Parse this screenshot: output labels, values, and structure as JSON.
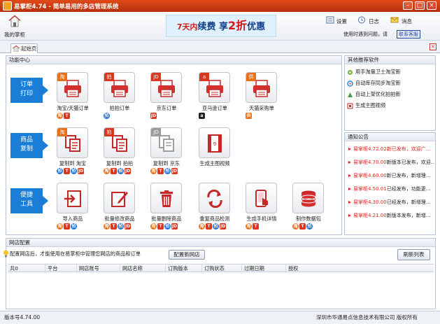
{
  "window": {
    "title": "易掌柜4.74 - 简单易用的多店管理系统"
  },
  "header": {
    "home_label": "我的掌柜",
    "banner": {
      "part1": "7天内",
      "part2": "续费 享",
      "part3": "2折",
      "part4": "优惠"
    },
    "settings_label": "设置",
    "log_label": "日志",
    "messages_label": "消息",
    "help_text": "使用时遇到问题，请",
    "help_link": "联系客服"
  },
  "tabs": [
    {
      "label": "起始页"
    }
  ],
  "function_center": {
    "title": "功能中心",
    "rows": [
      {
        "label_line1": "订单",
        "label_line2": "打印",
        "items": [
          {
            "label": "淘宝/天猫订单",
            "tag": "淘",
            "tag_color": "#e8711a",
            "badges": [
              "淘",
              "T"
            ]
          },
          {
            "label": "拍拍订单",
            "tag": "拍",
            "tag_color": "#d8361e",
            "badges": [
              "拍"
            ]
          },
          {
            "label": "京东订单",
            "tag": "JD",
            "tag_color": "#d8361e",
            "badges": [
              "JD"
            ]
          },
          {
            "label": "亚马逊订单",
            "tag": "a",
            "tag_color": "#d8361e",
            "badges": [
              "a"
            ]
          },
          {
            "label": "天猫采购单",
            "tag": "供",
            "tag_color": "#e8711a",
            "badges": [
              "供"
            ]
          }
        ]
      },
      {
        "label_line1": "商品",
        "label_line2": "复制",
        "items": [
          {
            "label": "复制到 淘宝",
            "tag": "淘",
            "tag_color": "#e8711a",
            "badges": [
              "拍",
              "T",
              "拍",
              "JD"
            ]
          },
          {
            "label": "复制到 拍拍",
            "tag": "拍",
            "tag_color": "#d8361e",
            "badges": [
              "淘",
              "T",
              "拍",
              "JD"
            ]
          },
          {
            "label": "复制到 京东",
            "tag": "JD",
            "tag_color": "#9c9c9c",
            "badges": [
              "淘",
              "T",
              "拍",
              "JD"
            ]
          },
          {
            "label": "生成主图视频",
            "tag": "",
            "tag_color": "",
            "badges": []
          }
        ]
      },
      {
        "label_line1": "便捷",
        "label_line2": "工具",
        "items": [
          {
            "label": "导入商品",
            "tag": "",
            "tag_color": "",
            "badges": [
              "淘",
              "T",
              "拍"
            ]
          },
          {
            "label": "批量修改商品",
            "tag": "",
            "tag_color": "",
            "badges": [
              "淘",
              "T",
              "拍",
              "JD"
            ]
          },
          {
            "label": "批量删除商品",
            "tag": "",
            "tag_color": "",
            "badges": [
              "淘",
              "T",
              "拍",
              "JD"
            ]
          },
          {
            "label": "重复商品检测",
            "tag": "",
            "tag_color": "",
            "badges": [
              "淘",
              "T",
              "拍",
              "JD"
            ]
          },
          {
            "label": "生成手机详情",
            "tag": "",
            "tag_color": "",
            "badges": [
              "淘",
              "T"
            ]
          },
          {
            "label": "制作数据包",
            "tag": "",
            "tag_color": "",
            "badges": [
              "淘",
              "T",
              "拍"
            ]
          }
        ]
      }
    ]
  },
  "recommend": {
    "title": "其他推荐软件",
    "items": [
      {
        "label": "用手淘量卫士淘宝新"
      },
      {
        "label": "自动库存同步淘宝新"
      },
      {
        "label": "自动上架优化拍拍新"
      },
      {
        "label": "生成主图视频"
      }
    ]
  },
  "notice": {
    "title": "通知公告",
    "items": [
      {
        "version": "易掌柜4.72.02",
        "text": "新已发布，欢迎广..."
      },
      {
        "version": "易掌柜4.70.00",
        "text": "新版本已发布，欢迎..."
      },
      {
        "version": "易掌柜4.60.00",
        "text": "新已发布，新增理..."
      },
      {
        "version": "易掌柜4.50.01",
        "text": "已经发布，功能更..."
      },
      {
        "version": "易掌柜4.30.00",
        "text": "已经发布，新增理..."
      },
      {
        "version": "易掌柜4.21.00",
        "text": "新版本发布，新增..."
      }
    ]
  },
  "store_config": {
    "title": "网店配置",
    "tip": "配置网店后，才能使用在易掌柜中管理您网店的商品和订单",
    "add_button": "配置新网店",
    "refresh_button": "刷新列表",
    "columns": [
      "共0",
      "平台",
      "网店账号",
      "网店名称",
      "订购版本",
      "订购状态",
      "过期日期",
      "授权"
    ]
  },
  "status": {
    "version": "版本号4.74.00",
    "copyright": "深圳市华通易点信息技术有限公司 版权所有"
  },
  "colors": {
    "title_bar": "#c8391a",
    "accent_blue": "#1a7ed6",
    "notice_red": "#d22222"
  }
}
